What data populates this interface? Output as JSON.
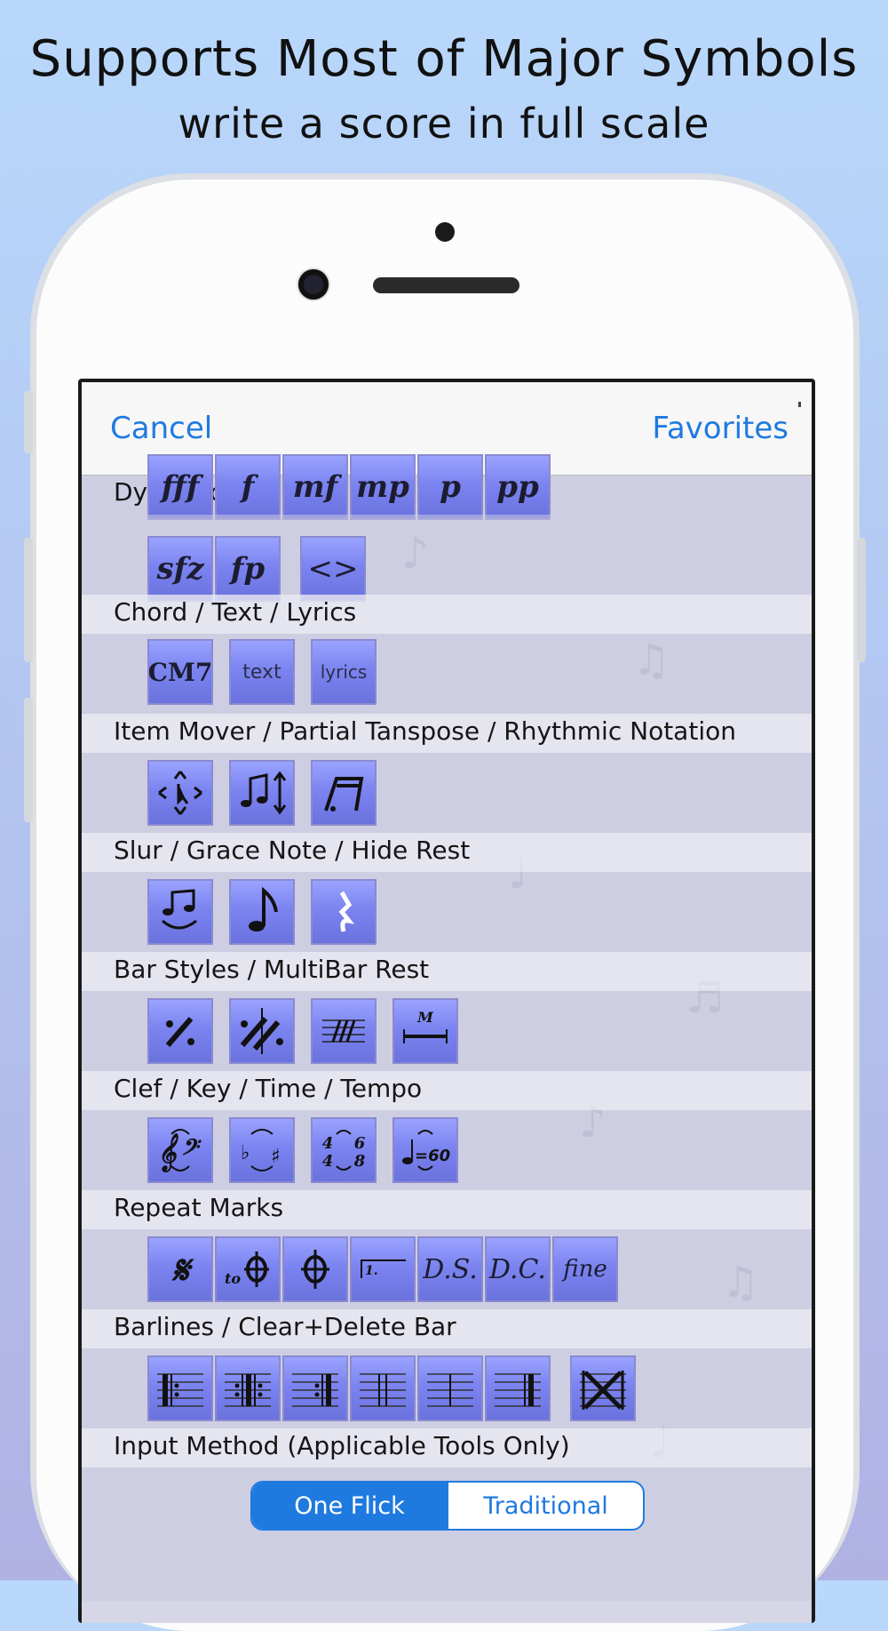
{
  "headline": "Supports Most of Major Symbols",
  "subheadline": "write a score in full scale",
  "nav": {
    "cancel": "Cancel",
    "favorites": "Favorites"
  },
  "sections": {
    "dynamics": {
      "label": "Dynamics",
      "tools": [
        "fff",
        "f",
        "mf",
        "mp",
        "p",
        "pp",
        "sfz",
        "fp",
        "<>"
      ]
    },
    "chord_text_lyrics": {
      "label": "Chord / Text / Lyrics",
      "tools": [
        "CM7",
        "text",
        "lyrics"
      ]
    },
    "item_mover": {
      "label": "Item Mover / Partial Tanspose / Rhythmic Notation",
      "icons": [
        "item-mover-icon",
        "partial-transpose-icon",
        "rhythmic-notation-icon"
      ]
    },
    "slur_grace": {
      "label": "Slur / Grace Note / Hide Rest",
      "icons": [
        "slur-icon",
        "grace-note-icon",
        "hide-rest-icon"
      ]
    },
    "bar_styles": {
      "label": "Bar Styles / MultiBar Rest",
      "tools": [
        "M"
      ],
      "icons": [
        "simile-icon",
        "double-simile-icon",
        "slash-bar-icon",
        "multibar-rest-icon"
      ]
    },
    "clef_key": {
      "label": "Clef / Key / Time / Tempo",
      "tools": [
        "4",
        "4",
        "6",
        "8",
        "=60"
      ],
      "icons": [
        "clef-icon",
        "key-signature-icon",
        "time-signature-icon",
        "tempo-icon"
      ]
    },
    "repeat_marks": {
      "label": "Repeat Marks",
      "tools": [
        "to",
        "1.",
        "D.S.",
        "D.C.",
        "fine"
      ],
      "icons": [
        "segno-icon",
        "to-coda-icon",
        "coda-icon",
        "volta-icon"
      ]
    },
    "barlines": {
      "label": "Barlines / Clear+Delete Bar",
      "icons": [
        "repeat-start-icon",
        "repeat-both-icon",
        "repeat-end-icon",
        "double-bar-icon",
        "single-bar-icon",
        "final-bar-icon",
        "clear-delete-bar-icon"
      ]
    },
    "input_method": {
      "label": "Input Method  (Applicable Tools Only)",
      "options": [
        "One Flick",
        "Traditional"
      ],
      "selected": "One Flick"
    }
  },
  "colors": {
    "accent": "#1f7ae0",
    "tool_fill": "#7b84f0",
    "background_top": "#b9d8fb",
    "background_bottom": "#b1b1e4"
  }
}
